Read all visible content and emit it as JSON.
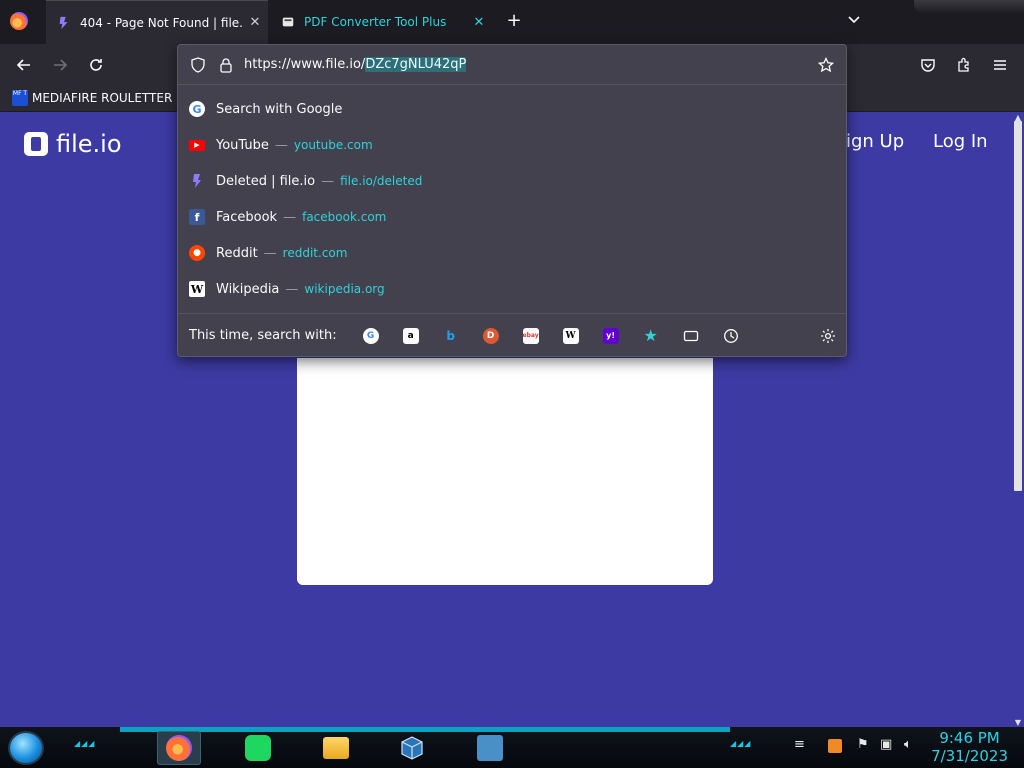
{
  "tabs": [
    {
      "title": "404 - Page Not Found | file.io",
      "active": true
    },
    {
      "title": "PDF Converter Tool Plus",
      "active": false
    }
  ],
  "urlbar": {
    "url_prefix": "https://www.file.io/",
    "url_selected": "DZc7gNLU42qP"
  },
  "bookmarks": [
    {
      "icon_text": "MF T",
      "label": "MEDIAFIRE ROULETTER"
    }
  ],
  "suggestions": {
    "search": {
      "label": "Search with Google",
      "icon": "google-icon"
    },
    "items": [
      {
        "title": "YouTube",
        "url": "youtube.com",
        "icon": "youtube-icon",
        "color": "#ff0000"
      },
      {
        "title": "Deleted | file.io",
        "url": "file.io/deleted",
        "icon": "fileio-icon",
        "color": "#7b68ee"
      },
      {
        "title": "Facebook",
        "url": "facebook.com",
        "icon": "facebook-icon",
        "color": "#1877f2"
      },
      {
        "title": "Reddit",
        "url": "reddit.com",
        "icon": "reddit-icon",
        "color": "#ff4500"
      },
      {
        "title": "Wikipedia",
        "url": "wikipedia.org",
        "icon": "wikipedia-icon",
        "color": "#ffffff"
      }
    ],
    "dash": "—"
  },
  "search_engines": {
    "label": "This time, search with:",
    "engines": [
      {
        "name": "google-icon",
        "glyph": "G",
        "bg": "#ffffff",
        "fg": "#4285f4"
      },
      {
        "name": "amazon-icon",
        "glyph": "a",
        "bg": "#ffffff",
        "fg": "#000000"
      },
      {
        "name": "bing-icon",
        "glyph": "b",
        "bg": "#42414d",
        "fg": "#1ea0f1"
      },
      {
        "name": "duckduckgo-icon",
        "glyph": "D",
        "bg": "#de5833",
        "fg": "#ffffff"
      },
      {
        "name": "ebay-icon",
        "glyph": "ebay",
        "bg": "#ffffff",
        "fg": "#e53238"
      },
      {
        "name": "wikipedia-icon",
        "glyph": "W",
        "bg": "#ffffff",
        "fg": "#000000"
      },
      {
        "name": "yahoo-icon",
        "glyph": "y!",
        "bg": "#6001d2",
        "fg": "#ffffff"
      },
      {
        "name": "bookmarks-search-icon",
        "glyph": "★",
        "bg": "#42414d",
        "fg": "#2fd3d8"
      },
      {
        "name": "tabs-search-icon",
        "glyph": "▭",
        "bg": "#42414d",
        "fg": "#fbfbfe"
      },
      {
        "name": "history-search-icon",
        "glyph": "◷",
        "bg": "#42414d",
        "fg": "#fbfbfe"
      }
    ]
  },
  "page": {
    "logo_text": "file.io",
    "signup": "ign Up",
    "login": "Log In"
  },
  "taskbar": {
    "time": "9:46 PM",
    "date": "7/31/2023"
  }
}
